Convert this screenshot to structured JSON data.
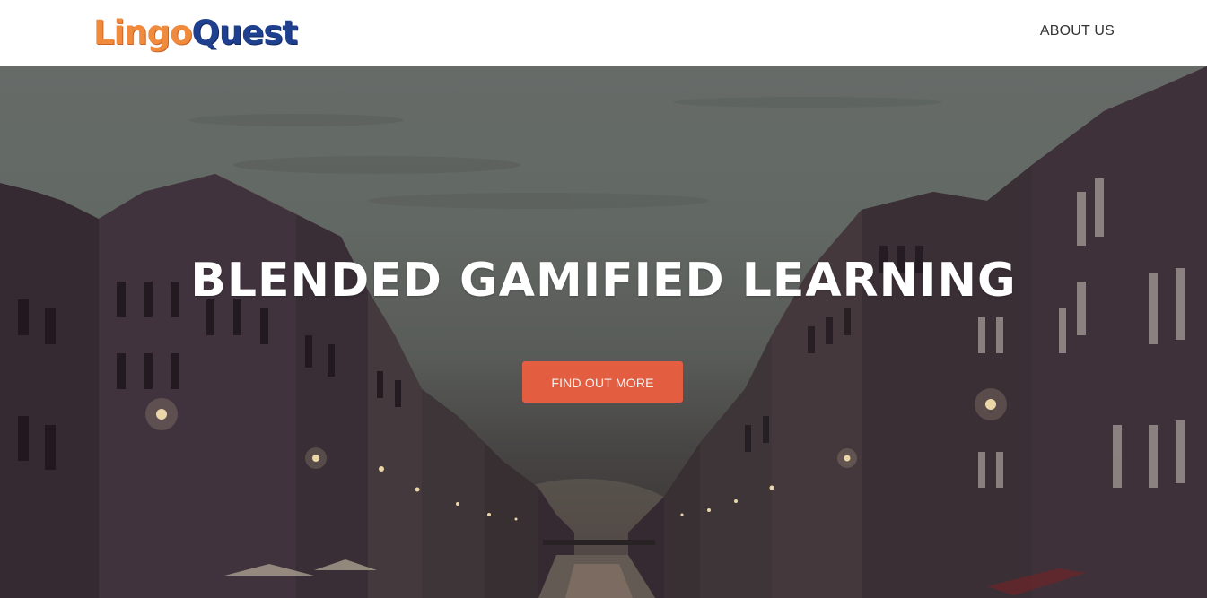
{
  "nav": {
    "brand_part1": "Lingo",
    "brand_part2": "Quest",
    "links": [
      {
        "label": "ABOUT US"
      }
    ]
  },
  "hero": {
    "title": "BLENDED GAMIFIED LEARNING",
    "button_label": "FIND OUT MORE",
    "background_image": "city-canal-dusk"
  },
  "colors": {
    "accent": "#f05f40",
    "brand_orange": "#f08a3c",
    "brand_blue": "#1f3f8f",
    "nav_text": "#333333"
  }
}
